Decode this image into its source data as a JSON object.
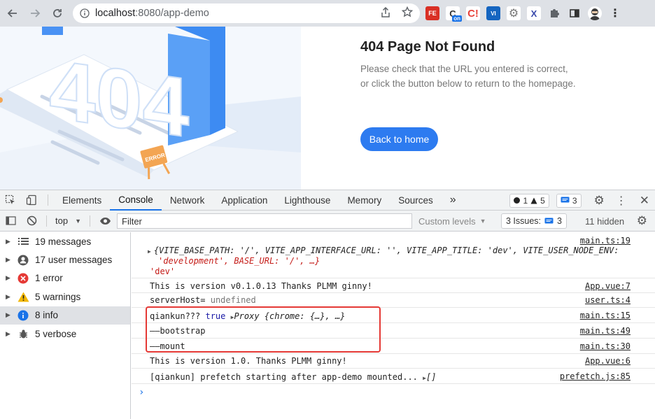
{
  "browser": {
    "url_host": "localhost",
    "url_path": ":8080/app-demo",
    "extensions": [
      {
        "name": "fe-extension-icon",
        "label": "FE",
        "color": "#d93025"
      },
      {
        "name": "on-extension-icon",
        "label": "on",
        "color": "#1a73e8"
      },
      {
        "name": "c-extension-icon",
        "label": "C",
        "color": "#e8453c"
      },
      {
        "name": "vi-extension-icon",
        "label": "VI",
        "color": "#1565c0"
      },
      {
        "name": "gear-extension-icon",
        "label": "⚙",
        "color": "#777777"
      },
      {
        "name": "x-extension-icon",
        "label": "X",
        "color": "#3949ab"
      }
    ]
  },
  "page": {
    "title": "404 Page Not Found",
    "description": "Please check that the URL you entered is correct, or click the button below to return to the homepage.",
    "button": "Back to home",
    "illustration_number": "404",
    "illustration_tag": "ERROR"
  },
  "devtools": {
    "tabs": [
      "Elements",
      "Console",
      "Network",
      "Application",
      "Lighthouse",
      "Memory",
      "Sources"
    ],
    "active_tab": "Console",
    "more": "»",
    "errors_count": "1",
    "warnings_count": "5",
    "messages_count": "3",
    "context": "top",
    "filter_placeholder": "Filter",
    "levels": "Custom levels",
    "issues": "3 Issues:",
    "issues_count": "3",
    "hidden": "11 hidden",
    "sidebar": [
      {
        "label": "19 messages",
        "icon": "list-icon"
      },
      {
        "label": "17 user messages",
        "icon": "user-icon"
      },
      {
        "label": "1 error",
        "icon": "error-icon"
      },
      {
        "label": "5 warnings",
        "icon": "warning-icon"
      },
      {
        "label": "8 info",
        "icon": "info-icon"
      },
      {
        "label": "5 verbose",
        "icon": "bug-icon"
      }
    ],
    "logs": {
      "env_src": "main.ts:19",
      "env_line1": "{VITE_BASE_PATH: '/', VITE_APP_INTERFACE_URL: '', VITE_APP_TITLE: 'dev', VITE_USER_NODE_ENV:",
      "env_line2": "'development', BASE_URL: '/', …}",
      "env_line3": "'dev'",
      "l1_text": "This is version v0.1.0.13 Thanks PLMM ginny!",
      "l1_src": "App.vue:7",
      "l2_text": "serverHost=",
      "l2_value": "undefined",
      "l2_src": "user.ts:4",
      "l3_text": "qiankun???",
      "l3_bool": "true",
      "l3_obj": "Proxy {chrome: {…}, …}",
      "l3_src": "main.ts:15",
      "l4_text": "——bootstrap",
      "l4_src": "main.ts:49",
      "l5_text": "——mount",
      "l5_src": "main.ts:30",
      "l6_text": "This is version 1.0. Thanks PLMM ginny!",
      "l6_src": "App.vue:6",
      "l7_text": "[qiankun] prefetch starting after app-demo mounted...",
      "l7_arr": "[]",
      "l7_src": "prefetch.js:85",
      "prompt": "›"
    }
  }
}
